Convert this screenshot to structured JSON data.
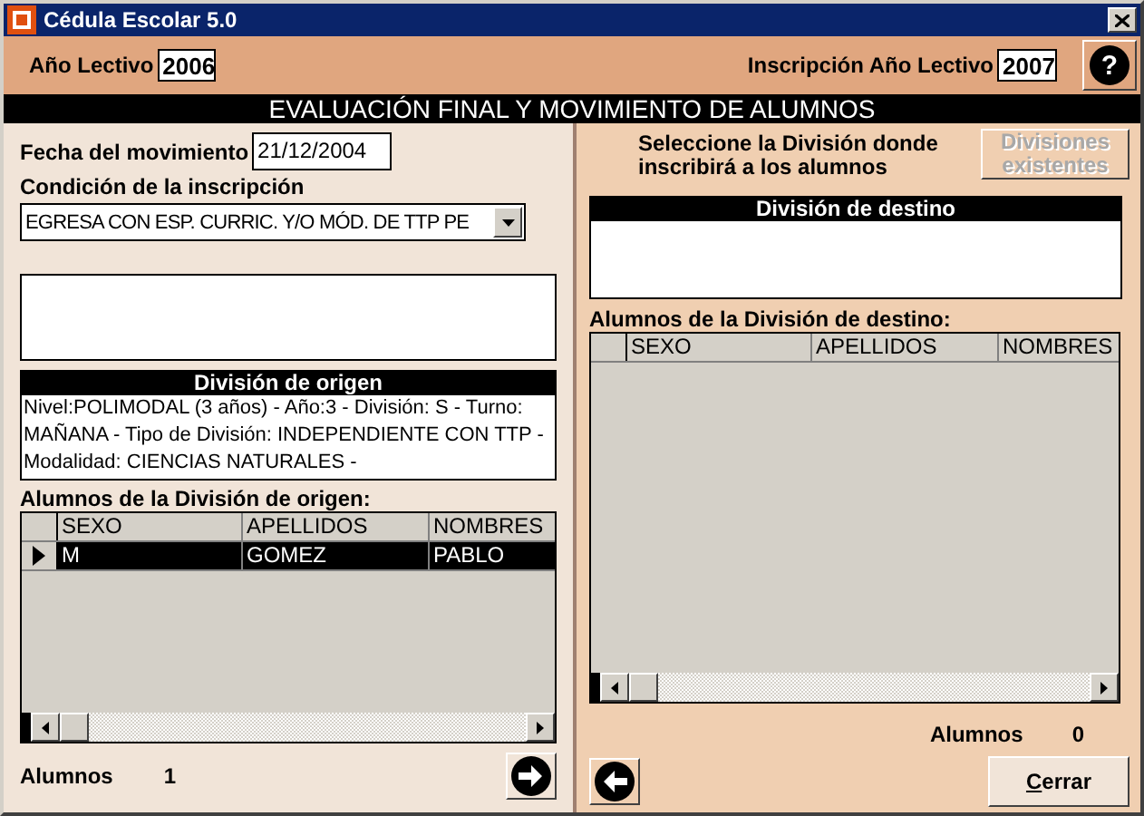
{
  "window": {
    "title": "Cédula Escolar 5.0"
  },
  "top_bar": {
    "year_label": "Año Lectivo",
    "year_value": "2006",
    "enroll_label": "Inscripción Año Lectivo",
    "enroll_value": "2007",
    "help_button": "?"
  },
  "header": "EVALUACIÓN FINAL Y MOVIMIENTO DE ALUMNOS",
  "left": {
    "date_label": "Fecha del movimiento",
    "date_value": "21/12/2004",
    "condition_label": "Condición de la inscripción",
    "condition_value": "EGRESA CON ESP. CURRIC. Y/O MÓD. DE TTP PE",
    "origin": {
      "title": "División de origen",
      "text": "Nivel:POLIMODAL (3 años) - Año:3 - División: S - Turno: MAÑANA - Tipo de División: INDEPENDIENTE CON TTP - Modalidad: CIENCIAS NATURALES -"
    },
    "students_label": "Alumnos de la División de origen:",
    "table": {
      "columns": [
        "SEXO",
        "APELLIDOS",
        "NOMBRES"
      ],
      "rows": [
        {
          "cells": [
            "M",
            "GOMEZ",
            "PABLO"
          ],
          "selected": true
        }
      ]
    },
    "count_label": "Alumnos",
    "count": "1"
  },
  "right": {
    "instruction": "Seleccione la División donde inscribirá a los alumnos",
    "divisions_button": {
      "label": "Divisiones existentes",
      "disabled": true
    },
    "destination": {
      "title": "División de destino"
    },
    "students_label": "Alumnos de la División de destino:",
    "table": {
      "columns": [
        "SEXO",
        "APELLIDOS",
        "NOMBRES"
      ]
    },
    "count_label": "Alumnos",
    "count": "0",
    "close_button": "Cerrar"
  }
}
